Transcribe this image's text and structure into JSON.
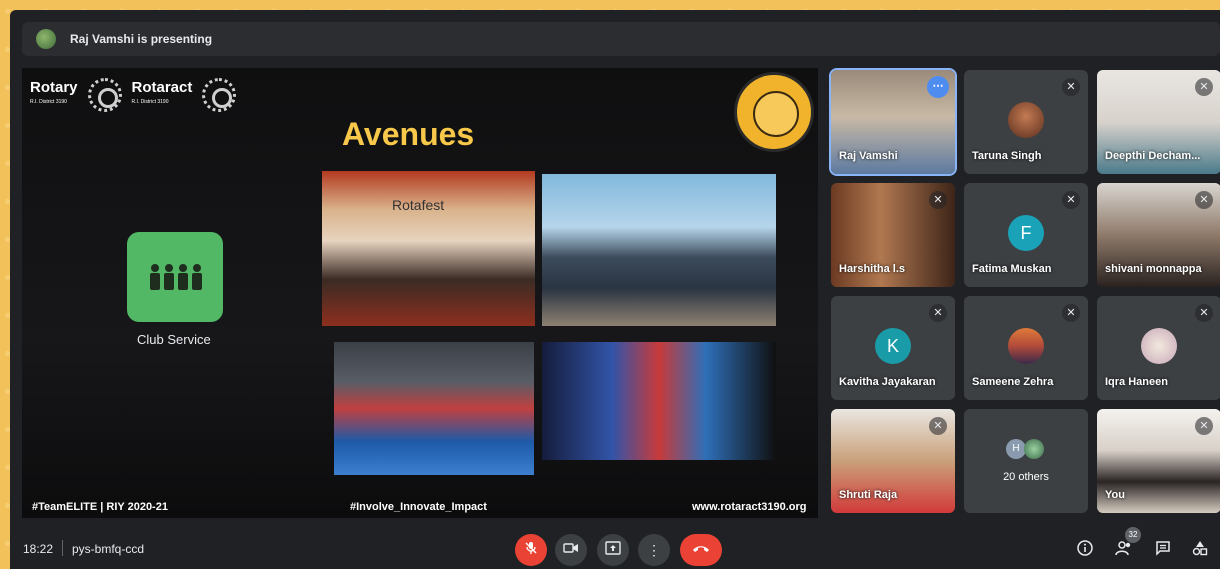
{
  "presenter": {
    "text": "Raj Vamshi is presenting"
  },
  "slide": {
    "logo_left": "Rotary",
    "logo_left_sub": "R.I. District 3190",
    "logo_right": "Rotaract",
    "logo_right_sub": "R.I. District 3190",
    "title": "Avenues",
    "club_label": "Club Service",
    "photo1_caption": "Rotafest",
    "footer_left": "#TeamELITE | RIY 2020-21",
    "footer_center": "#Involve_Innovate_Impact",
    "footer_right": "www.rotaract3190.org"
  },
  "participants": [
    {
      "name": "Raj Vamshi"
    },
    {
      "name": "Taruna Singh"
    },
    {
      "name": "Deepthi Decham..."
    },
    {
      "name": "Harshitha l.s"
    },
    {
      "name": "Fatima Muskan",
      "initial": "F"
    },
    {
      "name": "shivani monnappa"
    },
    {
      "name": "Kavitha Jayakaran",
      "initial": "K"
    },
    {
      "name": "Sameene Zehra"
    },
    {
      "name": "Iqra Haneen"
    },
    {
      "name": "Shruti Raja"
    },
    {
      "name": "20 others",
      "initial": "H"
    },
    {
      "name": "You"
    }
  ],
  "colors": {
    "fatima": "#1aa3b8",
    "kavitha": "#1a9ca8",
    "end_call": "#ea4335"
  },
  "bottom": {
    "time": "18:22",
    "meeting_code": "pys-bmfq-ccd",
    "participant_count": "32"
  },
  "icons": [
    "mic-off-icon",
    "camera-icon",
    "present-icon",
    "more-options-icon",
    "end-call-icon",
    "info-icon",
    "people-icon",
    "chat-icon",
    "activities-icon"
  ]
}
